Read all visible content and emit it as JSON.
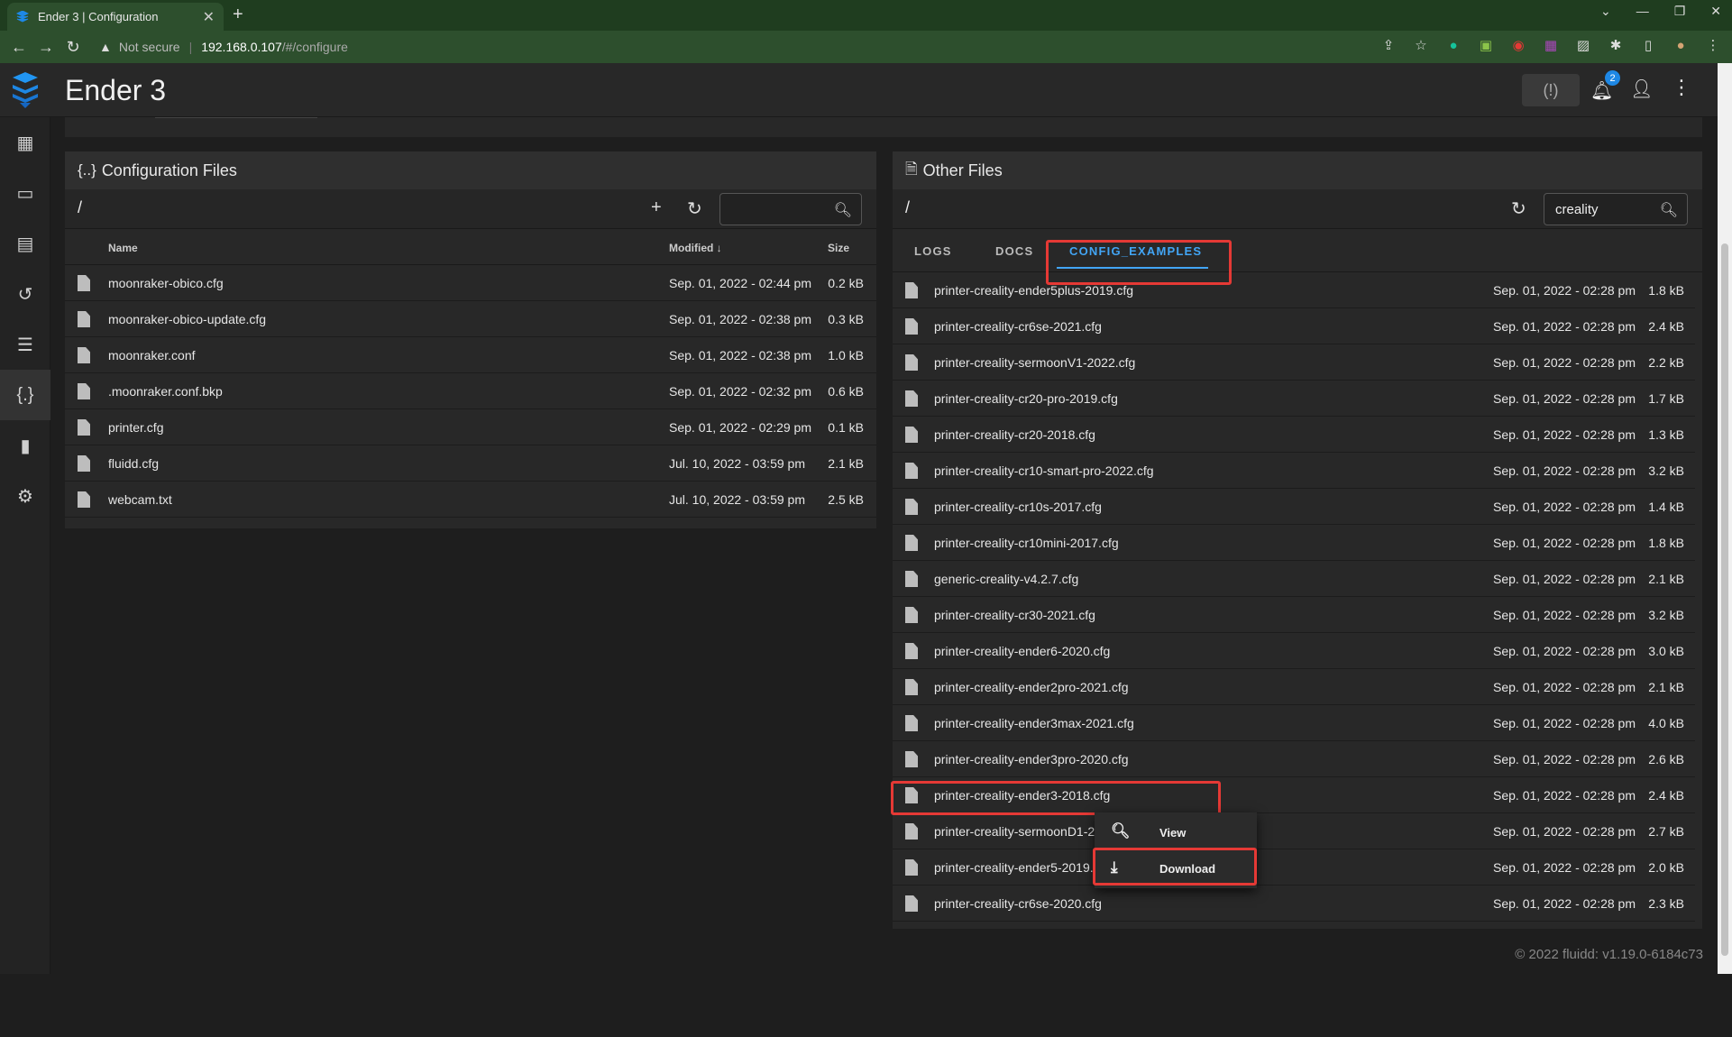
{
  "browser": {
    "tab_title": "Ender 3 | Configuration",
    "url_warning": "Not secure",
    "url_host": "192.168.0.107",
    "url_path": "/#/configure"
  },
  "app": {
    "title": "Ender 3",
    "notification_count": "2",
    "footer": "© 2022 fluidd: v1.19.0-6184c73"
  },
  "config_panel": {
    "title": "Configuration Files",
    "path": "/",
    "search_value": "",
    "columns": {
      "name": "Name",
      "modified": "Modified",
      "size": "Size"
    },
    "files": [
      {
        "name": "moonraker-obico.cfg",
        "modified": "Sep. 01, 2022 - 02:44 pm",
        "size": "0.2 kB"
      },
      {
        "name": "moonraker-obico-update.cfg",
        "modified": "Sep. 01, 2022 - 02:38 pm",
        "size": "0.3 kB"
      },
      {
        "name": "moonraker.conf",
        "modified": "Sep. 01, 2022 - 02:38 pm",
        "size": "1.0 kB"
      },
      {
        "name": ".moonraker.conf.bkp",
        "modified": "Sep. 01, 2022 - 02:32 pm",
        "size": "0.6 kB"
      },
      {
        "name": "printer.cfg",
        "modified": "Sep. 01, 2022 - 02:29 pm",
        "size": "0.1 kB"
      },
      {
        "name": "fluidd.cfg",
        "modified": "Jul. 10, 2022 - 03:59 pm",
        "size": "2.1 kB"
      },
      {
        "name": "webcam.txt",
        "modified": "Jul. 10, 2022 - 03:59 pm",
        "size": "2.5 kB"
      }
    ]
  },
  "other_panel": {
    "title": "Other Files",
    "path": "/",
    "search_value": "creality",
    "tabs": [
      {
        "label": "LOGS"
      },
      {
        "label": "DOCS"
      },
      {
        "label": "CONFIG_EXAMPLES"
      }
    ],
    "files": [
      {
        "name": "printer-creality-ender5plus-2019.cfg",
        "modified": "Sep. 01, 2022 - 02:28 pm",
        "size": "1.8 kB"
      },
      {
        "name": "printer-creality-cr6se-2021.cfg",
        "modified": "Sep. 01, 2022 - 02:28 pm",
        "size": "2.4 kB"
      },
      {
        "name": "printer-creality-sermoonV1-2022.cfg",
        "modified": "Sep. 01, 2022 - 02:28 pm",
        "size": "2.2 kB"
      },
      {
        "name": "printer-creality-cr20-pro-2019.cfg",
        "modified": "Sep. 01, 2022 - 02:28 pm",
        "size": "1.7 kB"
      },
      {
        "name": "printer-creality-cr20-2018.cfg",
        "modified": "Sep. 01, 2022 - 02:28 pm",
        "size": "1.3 kB"
      },
      {
        "name": "printer-creality-cr10-smart-pro-2022.cfg",
        "modified": "Sep. 01, 2022 - 02:28 pm",
        "size": "3.2 kB"
      },
      {
        "name": "printer-creality-cr10s-2017.cfg",
        "modified": "Sep. 01, 2022 - 02:28 pm",
        "size": "1.4 kB"
      },
      {
        "name": "printer-creality-cr10mini-2017.cfg",
        "modified": "Sep. 01, 2022 - 02:28 pm",
        "size": "1.8 kB"
      },
      {
        "name": "generic-creality-v4.2.7.cfg",
        "modified": "Sep. 01, 2022 - 02:28 pm",
        "size": "2.1 kB"
      },
      {
        "name": "printer-creality-cr30-2021.cfg",
        "modified": "Sep. 01, 2022 - 02:28 pm",
        "size": "3.2 kB"
      },
      {
        "name": "printer-creality-ender6-2020.cfg",
        "modified": "Sep. 01, 2022 - 02:28 pm",
        "size": "3.0 kB"
      },
      {
        "name": "printer-creality-ender2pro-2021.cfg",
        "modified": "Sep. 01, 2022 - 02:28 pm",
        "size": "2.1 kB"
      },
      {
        "name": "printer-creality-ender3max-2021.cfg",
        "modified": "Sep. 01, 2022 - 02:28 pm",
        "size": "4.0 kB"
      },
      {
        "name": "printer-creality-ender3pro-2020.cfg",
        "modified": "Sep. 01, 2022 - 02:28 pm",
        "size": "2.6 kB"
      },
      {
        "name": "printer-creality-ender3-2018.cfg",
        "modified": "Sep. 01, 2022 - 02:28 pm",
        "size": "2.4 kB"
      },
      {
        "name": "printer-creality-sermoonD1-2",
        "modified": "Sep. 01, 2022 - 02:28 pm",
        "size": "2.7 kB"
      },
      {
        "name": "printer-creality-ender5-2019.",
        "modified": "Sep. 01, 2022 - 02:28 pm",
        "size": "2.0 kB"
      },
      {
        "name": "printer-creality-cr6se-2020.cfg",
        "modified": "Sep. 01, 2022 - 02:28 pm",
        "size": "2.3 kB"
      }
    ]
  },
  "context_menu": {
    "view_label": "View",
    "download_label": "Download"
  },
  "icons": {
    "sidebar": [
      "dashboard-icon",
      "console-icon",
      "jobs-icon",
      "history-icon",
      "tune-icon",
      "configure-icon",
      "system-icon",
      "settings-icon"
    ]
  }
}
